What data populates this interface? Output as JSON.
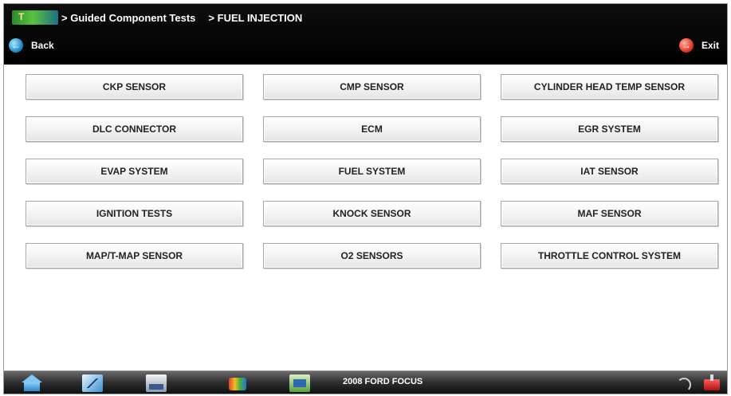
{
  "header": {
    "breadcrumbs": [
      "> Guided Component Tests",
      "> FUEL INJECTION"
    ],
    "back_label": "Back",
    "exit_label": "Exit"
  },
  "tests": [
    {
      "label": "CKP SENSOR"
    },
    {
      "label": "CMP SENSOR"
    },
    {
      "label": "CYLINDER HEAD TEMP SENSOR"
    },
    {
      "label": "DLC CONNECTOR"
    },
    {
      "label": "ECM"
    },
    {
      "label": "EGR SYSTEM"
    },
    {
      "label": "EVAP SYSTEM"
    },
    {
      "label": "FUEL SYSTEM"
    },
    {
      "label": "IAT SENSOR"
    },
    {
      "label": "IGNITION TESTS"
    },
    {
      "label": "KNOCK SENSOR"
    },
    {
      "label": "MAF SENSOR"
    },
    {
      "label": "MAP/T-MAP SENSOR"
    },
    {
      "label": "O2 SENSORS"
    },
    {
      "label": "THROTTLE CONTROL SYSTEM"
    }
  ],
  "toolbar": {
    "vehicle": "2008 FORD FOCUS",
    "icons": [
      "home-icon",
      "snapshot-icon",
      "print-icon",
      "tools-icon",
      "data-icon",
      "signal-icon",
      "power-icon"
    ]
  },
  "colors": {
    "header_bg": "#000000",
    "back_icon": "#2490c8",
    "exit_icon": "#e53a2a",
    "button_bg": "#f1f1f1"
  }
}
